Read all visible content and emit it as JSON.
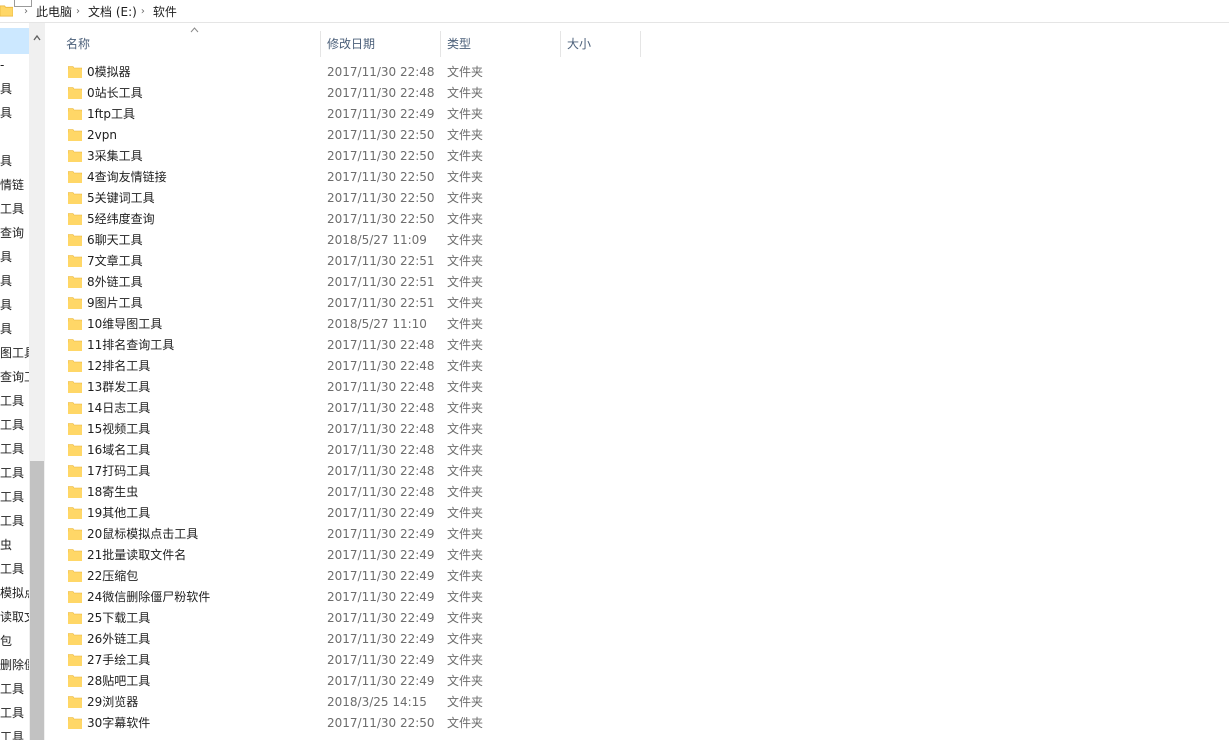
{
  "address": {
    "crumbs": [
      "此电脑",
      "文档 (E:)",
      "软件"
    ]
  },
  "nav": {
    "items": [
      "",
      "-",
      "具",
      "具",
      "",
      "具",
      "情链",
      "工具",
      "查询",
      "具",
      "具",
      "具",
      "具",
      "图工具",
      "查询工",
      "工具",
      "工具",
      "工具",
      "工具",
      "工具",
      "工具",
      "虫",
      "工具",
      "模拟点",
      "读取文",
      "包",
      "删除僵",
      "工具",
      "工具",
      "工具"
    ]
  },
  "columns": {
    "name": "名称",
    "date": "修改日期",
    "type": "类型",
    "size": "大小"
  },
  "files": [
    {
      "name": "0模拟器",
      "date": "2017/11/30 22:48",
      "type": "文件夹"
    },
    {
      "name": "0站长工具",
      "date": "2017/11/30 22:48",
      "type": "文件夹"
    },
    {
      "name": "1ftp工具",
      "date": "2017/11/30 22:49",
      "type": "文件夹"
    },
    {
      "name": "2vpn",
      "date": "2017/11/30 22:50",
      "type": "文件夹"
    },
    {
      "name": "3采集工具",
      "date": "2017/11/30 22:50",
      "type": "文件夹"
    },
    {
      "name": "4查询友情链接",
      "date": "2017/11/30 22:50",
      "type": "文件夹"
    },
    {
      "name": "5关键词工具",
      "date": "2017/11/30 22:50",
      "type": "文件夹"
    },
    {
      "name": "5经纬度查询",
      "date": "2017/11/30 22:50",
      "type": "文件夹"
    },
    {
      "name": "6聊天工具",
      "date": "2018/5/27 11:09",
      "type": "文件夹"
    },
    {
      "name": "7文章工具",
      "date": "2017/11/30 22:51",
      "type": "文件夹"
    },
    {
      "name": "8外链工具",
      "date": "2017/11/30 22:51",
      "type": "文件夹"
    },
    {
      "name": "9图片工具",
      "date": "2017/11/30 22:51",
      "type": "文件夹"
    },
    {
      "name": "10维导图工具",
      "date": "2018/5/27 11:10",
      "type": "文件夹"
    },
    {
      "name": "11排名查询工具",
      "date": "2017/11/30 22:48",
      "type": "文件夹"
    },
    {
      "name": "12排名工具",
      "date": "2017/11/30 22:48",
      "type": "文件夹"
    },
    {
      "name": "13群发工具",
      "date": "2017/11/30 22:48",
      "type": "文件夹"
    },
    {
      "name": "14日志工具",
      "date": "2017/11/30 22:48",
      "type": "文件夹"
    },
    {
      "name": "15视频工具",
      "date": "2017/11/30 22:48",
      "type": "文件夹"
    },
    {
      "name": "16域名工具",
      "date": "2017/11/30 22:48",
      "type": "文件夹"
    },
    {
      "name": "17打码工具",
      "date": "2017/11/30 22:48",
      "type": "文件夹"
    },
    {
      "name": "18寄生虫",
      "date": "2017/11/30 22:48",
      "type": "文件夹"
    },
    {
      "name": "19其他工具",
      "date": "2017/11/30 22:49",
      "type": "文件夹"
    },
    {
      "name": "20鼠标模拟点击工具",
      "date": "2017/11/30 22:49",
      "type": "文件夹"
    },
    {
      "name": "21批量读取文件名",
      "date": "2017/11/30 22:49",
      "type": "文件夹"
    },
    {
      "name": "22压缩包",
      "date": "2017/11/30 22:49",
      "type": "文件夹"
    },
    {
      "name": "24微信删除僵尸粉软件",
      "date": "2017/11/30 22:49",
      "type": "文件夹"
    },
    {
      "name": "25下载工具",
      "date": "2017/11/30 22:49",
      "type": "文件夹"
    },
    {
      "name": "26外链工具",
      "date": "2017/11/30 22:49",
      "type": "文件夹"
    },
    {
      "name": "27手绘工具",
      "date": "2017/11/30 22:49",
      "type": "文件夹"
    },
    {
      "name": "28贴吧工具",
      "date": "2017/11/30 22:49",
      "type": "文件夹"
    },
    {
      "name": "29浏览器",
      "date": "2018/3/25 14:15",
      "type": "文件夹"
    },
    {
      "name": "30字幕软件",
      "date": "2017/11/30 22:50",
      "type": "文件夹"
    }
  ],
  "colors": {
    "folder": "#ffd767",
    "folder_dark": "#e8b33a",
    "header_text": "#4c607a",
    "selection": "#cce8ff"
  }
}
